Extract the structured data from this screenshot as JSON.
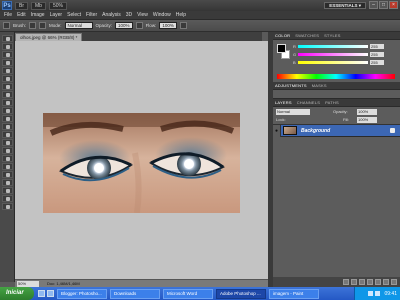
{
  "appbar": {
    "logo": "Ps",
    "br_label": "Br",
    "mb_label": "Mb",
    "zoom": "50%",
    "workspace": "ESSENTIALS ▾",
    "min": "–",
    "max": "□",
    "close": "×"
  },
  "menu": [
    "File",
    "Edit",
    "Image",
    "Layer",
    "Select",
    "Filter",
    "Analysis",
    "3D",
    "View",
    "Window",
    "Help"
  ],
  "options": {
    "brush_label": "Brush:",
    "mode_label": "Mode:",
    "mode_value": "Normal",
    "opacity_label": "Opacity:",
    "opacity_value": "100%",
    "flow_label": "Flow:",
    "flow_value": "100%"
  },
  "document": {
    "tab_title": "olhos.jpeg @ 66% (RGB/8) *",
    "zoom": "50%",
    "info": "Doc: 1,46M/1,46M"
  },
  "colorpanel": {
    "tabs": [
      "COLOR",
      "SWATCHES",
      "STYLES"
    ],
    "sliders": [
      {
        "letter": "R",
        "value": "255",
        "gradient": "#ff6b6b"
      },
      {
        "letter": "G",
        "value": "255",
        "gradient": "#d24cff"
      },
      {
        "letter": "B",
        "value": "255",
        "gradient": "#6b8cff"
      }
    ]
  },
  "adjustments": {
    "tabs": [
      "ADJUSTMENTS",
      "MASKS"
    ]
  },
  "layers": {
    "tabs": [
      "LAYERS",
      "CHANNELS",
      "PATHS"
    ],
    "blend_mode": "Normal",
    "opacity_label": "Opacity:",
    "opacity_value": "100%",
    "lock_label": "Lock:",
    "fill_label": "Fill:",
    "fill_value": "100%",
    "layer_name": "Background"
  },
  "taskbar": {
    "start": "Iniciar",
    "tasks": [
      {
        "label": "Blogger: Photosho...",
        "active": false
      },
      {
        "label": "Downloads",
        "active": false
      },
      {
        "label": "Microsoft Word",
        "active": false
      },
      {
        "label": "Adobe Photoshop ...",
        "active": true
      },
      {
        "label": "imagem - Paint",
        "active": false
      }
    ],
    "clock": "09:41"
  }
}
